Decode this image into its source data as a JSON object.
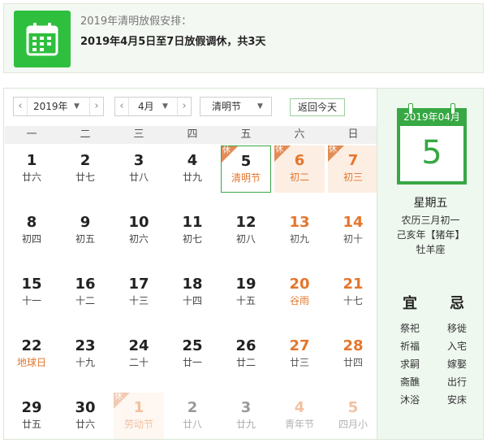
{
  "notice": {
    "title": "2019年清明放假安排：",
    "detail": "2019年4月5日至7日放假调休，共3天"
  },
  "toolbar": {
    "year": "2019年",
    "month": "4月",
    "holiday": "清明节",
    "today_label": "返回今天"
  },
  "weekdays": [
    "一",
    "二",
    "三",
    "四",
    "五",
    "六",
    "日"
  ],
  "holiday_badge": "休",
  "days": [
    {
      "n": "1",
      "l": "廿六"
    },
    {
      "n": "2",
      "l": "廿七"
    },
    {
      "n": "3",
      "l": "廿八"
    },
    {
      "n": "4",
      "l": "廿九"
    },
    {
      "n": "5",
      "l": "清明节"
    },
    {
      "n": "6",
      "l": "初二"
    },
    {
      "n": "7",
      "l": "初三"
    },
    {
      "n": "8",
      "l": "初四"
    },
    {
      "n": "9",
      "l": "初五"
    },
    {
      "n": "10",
      "l": "初六"
    },
    {
      "n": "11",
      "l": "初七"
    },
    {
      "n": "12",
      "l": "初八"
    },
    {
      "n": "13",
      "l": "初九"
    },
    {
      "n": "14",
      "l": "初十"
    },
    {
      "n": "15",
      "l": "十一"
    },
    {
      "n": "16",
      "l": "十二"
    },
    {
      "n": "17",
      "l": "十三"
    },
    {
      "n": "18",
      "l": "十四"
    },
    {
      "n": "19",
      "l": "十五"
    },
    {
      "n": "20",
      "l": "谷雨"
    },
    {
      "n": "21",
      "l": "十七"
    },
    {
      "n": "22",
      "l": "地球日"
    },
    {
      "n": "23",
      "l": "十九"
    },
    {
      "n": "24",
      "l": "二十"
    },
    {
      "n": "25",
      "l": "廿一"
    },
    {
      "n": "26",
      "l": "廿二"
    },
    {
      "n": "27",
      "l": "廿三"
    },
    {
      "n": "28",
      "l": "廿四"
    },
    {
      "n": "29",
      "l": "廿五"
    },
    {
      "n": "30",
      "l": "廿六"
    },
    {
      "n": "1",
      "l": "劳动节"
    },
    {
      "n": "2",
      "l": "廿八"
    },
    {
      "n": "3",
      "l": "廿九"
    },
    {
      "n": "4",
      "l": "青年节"
    },
    {
      "n": "5",
      "l": "四月小"
    }
  ],
  "side": {
    "card_header": "2019年04月",
    "card_day": "5",
    "weekday": "星期五",
    "lunar": "农历三月初一",
    "ganzhi": "己亥年【猪年】",
    "constellation": "牡羊座",
    "yi_title": "宜",
    "ji_title": "忌",
    "yi_items": [
      "祭祀",
      "祈福",
      "求嗣",
      "斋醮",
      "沐浴"
    ],
    "ji_items": [
      "移徙",
      "入宅",
      "嫁娶",
      "出行",
      "安床"
    ]
  },
  "colors": {
    "accent_green": "#37a843",
    "holiday_orange": "#e4762c"
  }
}
